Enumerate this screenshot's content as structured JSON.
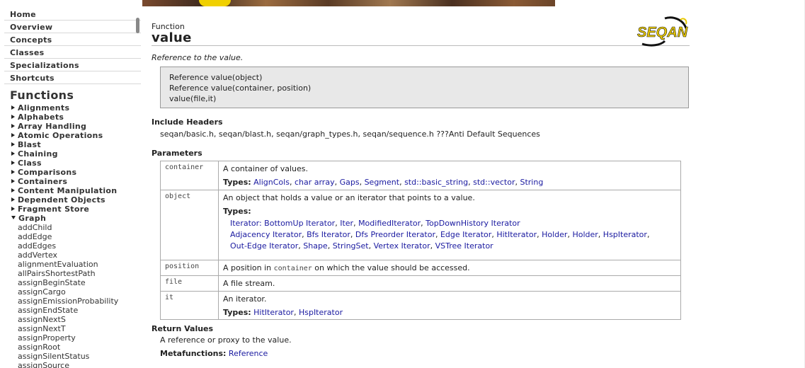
{
  "sidebar": {
    "nav": [
      "Home",
      "Overview",
      "Concepts",
      "Classes",
      "Specializations",
      "Shortcuts"
    ],
    "functions_heading": "Functions",
    "categories": [
      "Alignments",
      "Alphabets",
      "Array Handling",
      "Atomic Operations",
      "Blast",
      "Chaining",
      "Class",
      "Comparisons",
      "Containers",
      "Content Manipulation",
      "Dependent Objects",
      "Fragment Store"
    ],
    "open_category": "Graph",
    "graph_functions": [
      "addChild",
      "addEdge",
      "addEdges",
      "addVertex",
      "alignmentEvaluation",
      "allPairsShortestPath",
      "assignBeginState",
      "assignCargo",
      "assignEmissionProbability",
      "assignEndState",
      "assignNextS",
      "assignNextT",
      "assignProperty",
      "assignRoot",
      "assignSilentStatus",
      "assignSource"
    ]
  },
  "header": {
    "kind": "Function",
    "title": "value",
    "summary": "Reference to the value.",
    "logo_text": "SEQAN"
  },
  "signatures": [
    "Reference value(object)",
    "Reference value(container, position)",
    "value(file,it)"
  ],
  "include": {
    "heading": "Include Headers",
    "text": "seqan/basic.h, seqan/blast.h, seqan/graph_types.h, seqan/sequence.h ???Anti Default Sequences"
  },
  "parameters": {
    "heading": "Parameters",
    "types_label": "Types:",
    "container": {
      "name": "container",
      "desc": "A container of values.",
      "types": [
        "AlignCols",
        "char array",
        "Gaps",
        "Segment",
        "std::basic_string",
        "std::vector",
        "String"
      ]
    },
    "object": {
      "name": "object",
      "desc": "An object that holds a value or an iterator that points to a value.",
      "iterator_line": "Iterator: ",
      "iterator_types": [
        "BottomUp Iterator",
        "Iter",
        "ModifiedIterator",
        "TopDownHistory Iterator"
      ],
      "line2": [
        "Adjacency Iterator",
        "Bfs Iterator",
        "Dfs Preorder Iterator",
        "Edge Iterator",
        "HitIterator",
        "Holder",
        "Holder",
        "HspIterator"
      ],
      "line3": [
        "Out-Edge Iterator",
        "Shape",
        "StringSet",
        "Vertex Iterator",
        "VSTree Iterator"
      ]
    },
    "position": {
      "name": "position",
      "desc_before": "A position in ",
      "desc_code": "container",
      "desc_after": " on which the value should be accessed."
    },
    "file": {
      "name": "file",
      "desc": "A file stream."
    },
    "it": {
      "name": "it",
      "desc": "An iterator.",
      "types": [
        "HitIterator",
        "HspIterator"
      ]
    }
  },
  "returns": {
    "heading": "Return Values",
    "text": "A reference or proxy to the value.",
    "meta_label": "Metafunctions:",
    "meta_link": "Reference"
  }
}
